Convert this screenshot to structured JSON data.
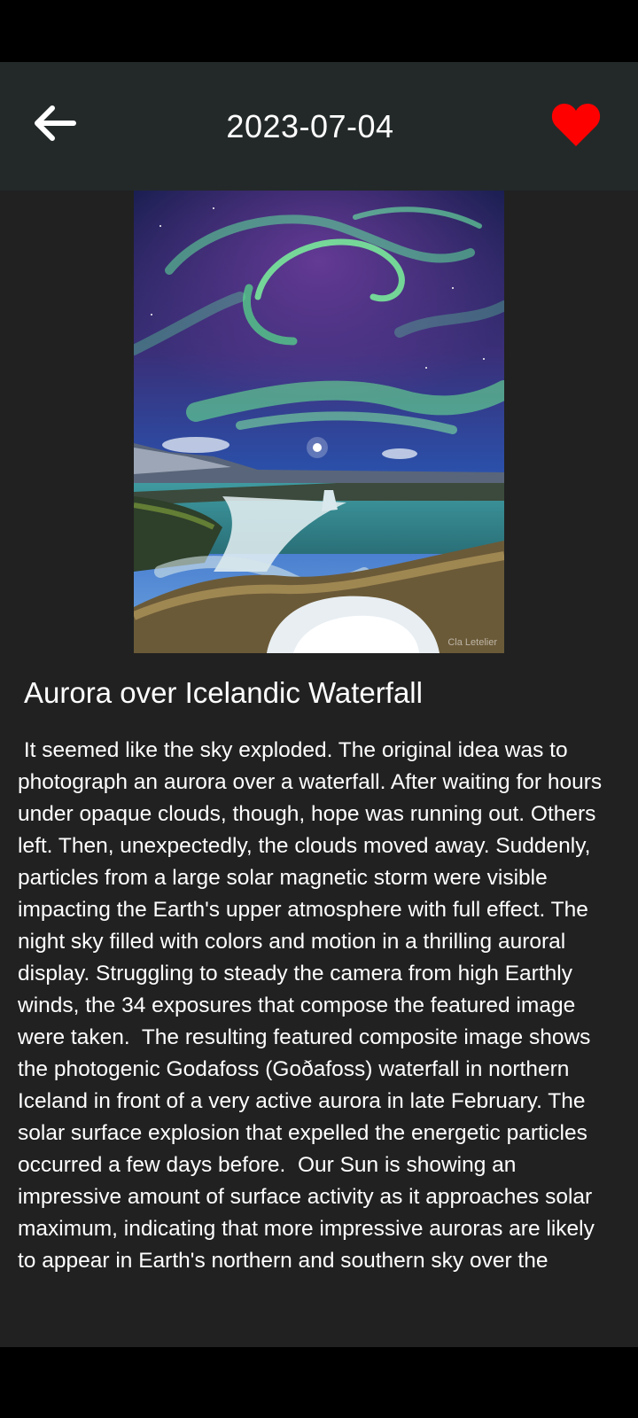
{
  "header": {
    "date": "2023-07-04",
    "back_icon": "arrow-left-icon",
    "favorite_icon": "heart-icon",
    "favorite_color": "#ff0000"
  },
  "apod": {
    "image_credit": "Cla Letelier",
    "title": "Aurora over Icelandic Waterfall",
    "explanation": " It seemed like the sky exploded. The original idea was to photograph an aurora over a waterfall. After waiting for hours under opaque clouds, though, hope was running out. Others left. Then, unexpectedly, the clouds moved away. Suddenly, particles from a large solar magnetic storm were visible impacting the Earth's upper atmosphere with full effect. The night sky filled with colors and motion in a thrilling auroral display. Struggling to steady the camera from high Earthly winds, the 34 exposures that compose the featured image were taken.  The resulting featured composite image shows the photogenic Godafoss (Goðafoss) waterfall in northern Iceland in front of a very active aurora in late February. The solar surface explosion that expelled the energetic particles occurred a few days before.  Our Sun is showing an impressive amount of surface activity as it approaches solar maximum, indicating that more impressive auroras are likely to appear in Earth's northern and southern sky over the"
  },
  "colors": {
    "app_bar": "#232929",
    "background": "#212121",
    "text": "#ffffff"
  }
}
